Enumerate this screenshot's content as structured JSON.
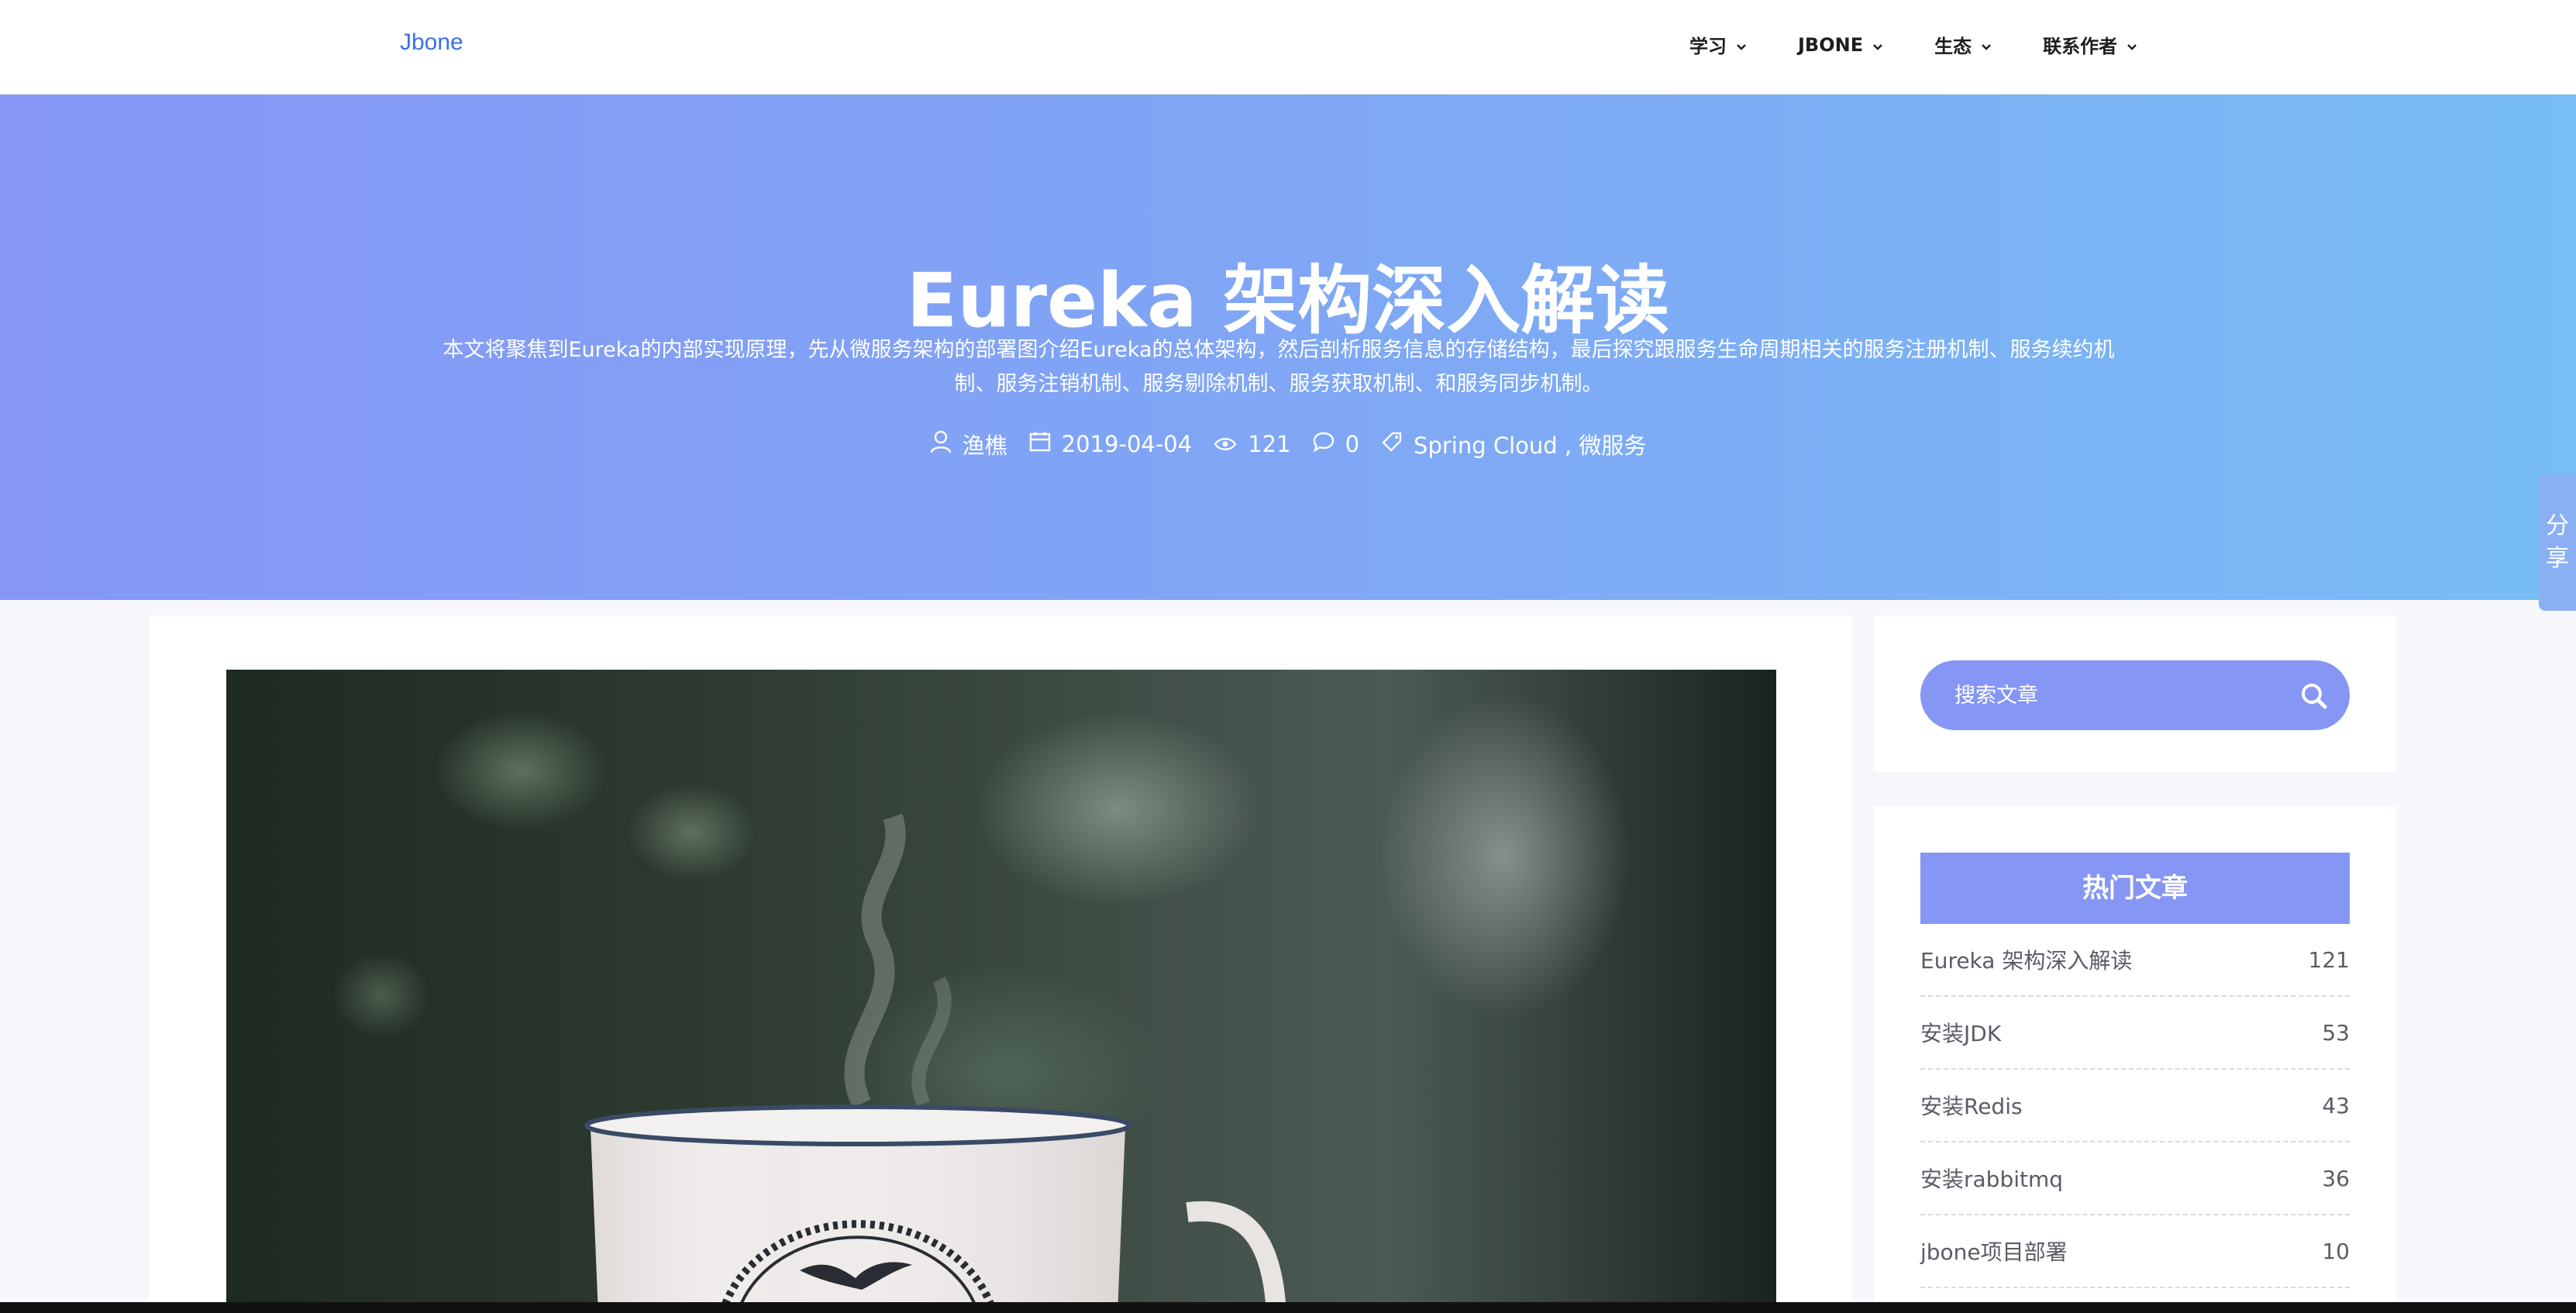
{
  "navbar": {
    "brand": "Jbone",
    "menu": [
      {
        "label": "学习"
      },
      {
        "label": "JBONE"
      },
      {
        "label": "生态"
      },
      {
        "label": "联系作者"
      }
    ]
  },
  "hero": {
    "title": "Eureka 架构深入解读",
    "description_line1": "本文将聚焦到Eureka的内部实现原理，先从微服务架构的部署图介绍Eureka的总体架构，然后剖析服务信息的存储结构，最后探究跟服务生命周期相关的服务注册机制、服务续约机",
    "description_line2": "制、服务注销机制、服务剔除机制、服务获取机制、和服务同步机制。",
    "meta": {
      "author": "渔樵",
      "date": "2019-04-04",
      "views": "121",
      "comments": "0",
      "tags": "Spring Cloud , 微服务"
    }
  },
  "share": {
    "label": "分享",
    "char1": "分",
    "char2": "享"
  },
  "sidebar": {
    "search": {
      "placeholder": "搜索文章"
    },
    "hot": {
      "title": "热门文章",
      "items": [
        {
          "title": "Eureka 架构深入解读",
          "count": "121"
        },
        {
          "title": "安装JDK",
          "count": "53"
        },
        {
          "title": "安装Redis",
          "count": "43"
        },
        {
          "title": "安装rabbitmq",
          "count": "36"
        },
        {
          "title": "jbone项目部署",
          "count": "10"
        }
      ]
    }
  },
  "colors": {
    "accent": "#8596f5",
    "brand": "#3b6fe3",
    "hero_gradient_start": "#8596f5",
    "hero_gradient_end": "#78bdf5"
  },
  "icons": {
    "author": "user-icon",
    "date": "calendar-icon",
    "views": "eye-icon",
    "comments": "comment-icon",
    "tags": "tag-icon",
    "search": "search-icon",
    "dropdown": "chevron-down-icon"
  }
}
